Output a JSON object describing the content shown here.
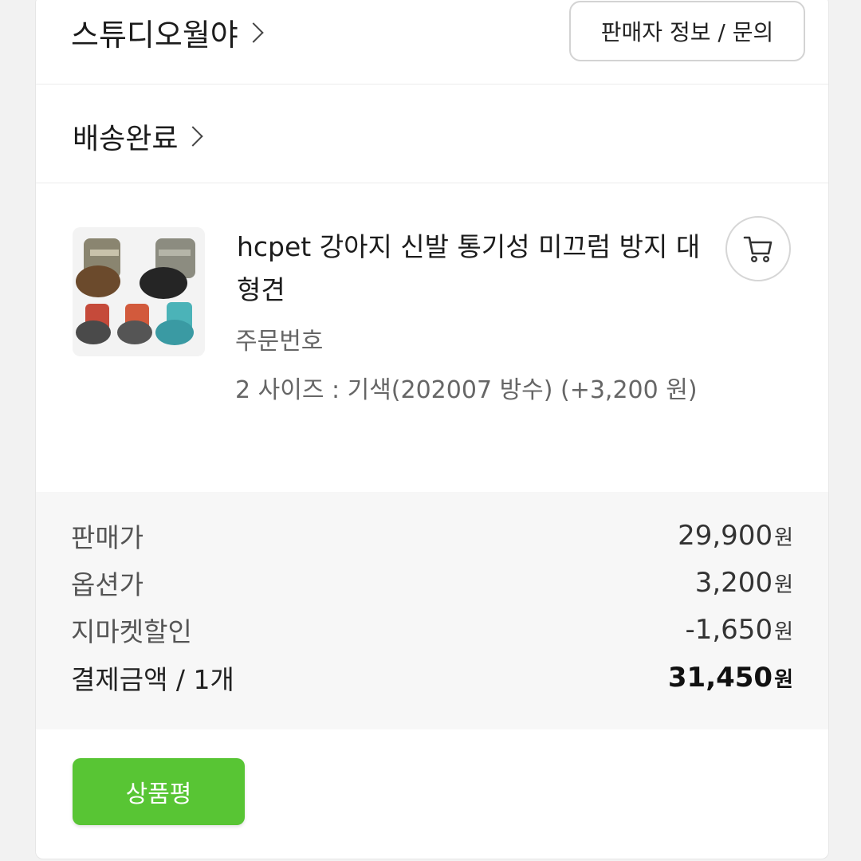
{
  "seller": {
    "name": "스튜디오월야",
    "info_button": "판매자 정보 / 문의"
  },
  "order": {
    "status": "배송완료",
    "product_title": "hcpet 강아지 신발 통기성 미끄럼 방지 대형견",
    "order_number_label": "주문번호",
    "option_text": "2 사이즈 : 기색(202007 방수) (+3,200 원)",
    "cart_icon": "cart-icon"
  },
  "prices": {
    "rows": [
      {
        "label": "판매가",
        "value": "29,900",
        "unit": "원"
      },
      {
        "label": "옵션가",
        "value": "3,200",
        "unit": "원"
      },
      {
        "label": "지마켓할인",
        "value": "-1,650",
        "unit": "원"
      }
    ],
    "total": {
      "label": "결제금액 / 1개",
      "value": "31,450",
      "unit": "원"
    }
  },
  "actions": {
    "review_button": "상품평"
  },
  "colors": {
    "accent_green": "#58c534"
  }
}
